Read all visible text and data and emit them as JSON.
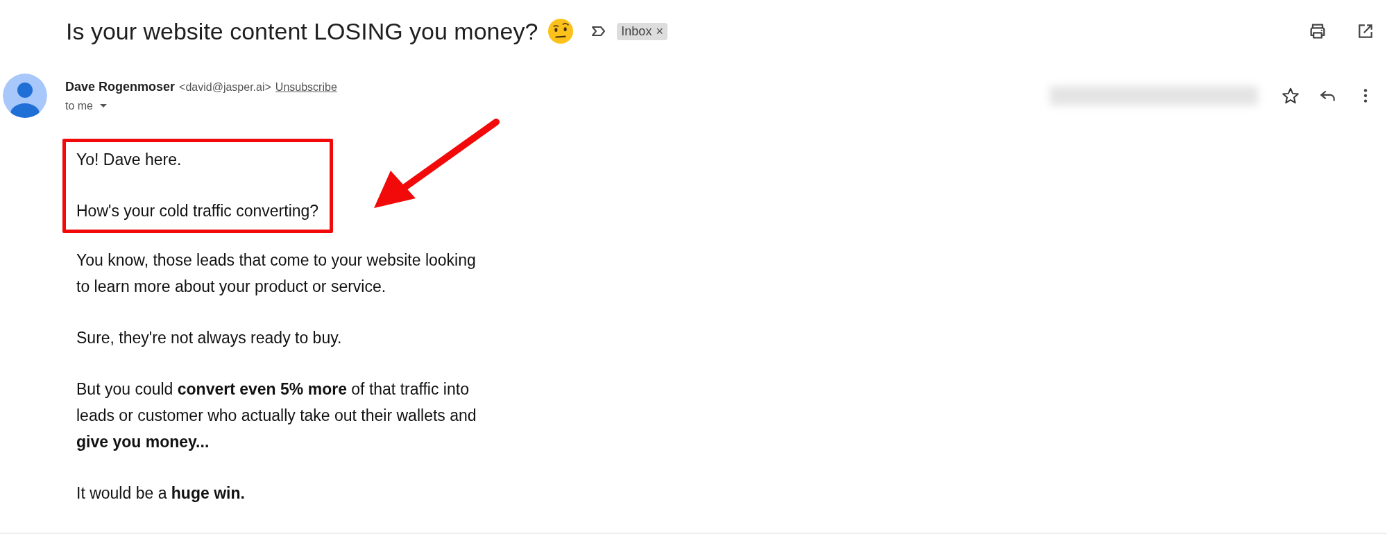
{
  "subject": {
    "title": "Is your website content LOSING you money?",
    "label": "Inbox",
    "label_close": "×"
  },
  "sender": {
    "name": "Dave Rogenmoser",
    "email": "<david@jasper.ai>",
    "unsubscribe": "Unsubscribe",
    "recipient": "to me",
    "starred": false
  },
  "body": {
    "highlighted_paragraphs": [
      "Yo! Dave here.",
      "How's your cold traffic converting?"
    ],
    "paragraphs": [
      "You know, those leads that come to your website looking to learn more about your product or service.",
      "Sure, they're not always ready to buy.",
      "But you could **convert even 5% more** of that traffic into leads or customer who actually take out their wallets and **give you money...**",
      "It would be a **huge win.**"
    ]
  }
}
